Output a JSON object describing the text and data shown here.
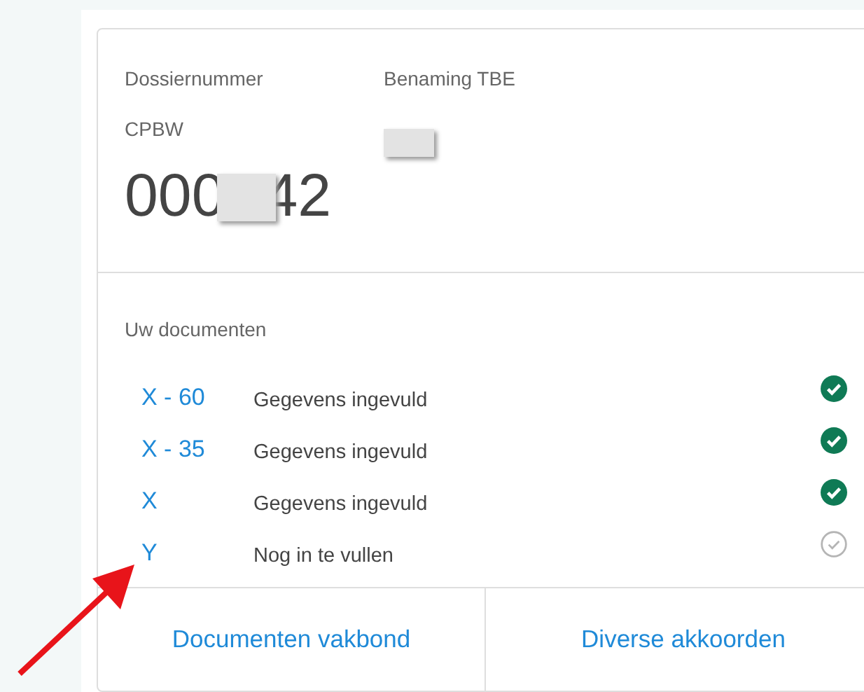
{
  "dossier": {
    "label": "Dossiernummer",
    "sublabel": "CPBW",
    "number_parts": [
      "000",
      "42"
    ]
  },
  "tbe": {
    "label": "Benaming TBE"
  },
  "documents": {
    "title": "Uw documenten",
    "items": [
      {
        "code": "X - 60",
        "status": "Gegevens ingevuld",
        "done": true
      },
      {
        "code": "X - 35",
        "status": "Gegevens ingevuld",
        "done": true
      },
      {
        "code": "X",
        "status": "Gegevens ingevuld",
        "done": true
      },
      {
        "code": "Y",
        "status": "Nog in te vullen",
        "done": false
      }
    ]
  },
  "links": [
    "Documenten vakbond",
    "Diverse akkoorden"
  ]
}
